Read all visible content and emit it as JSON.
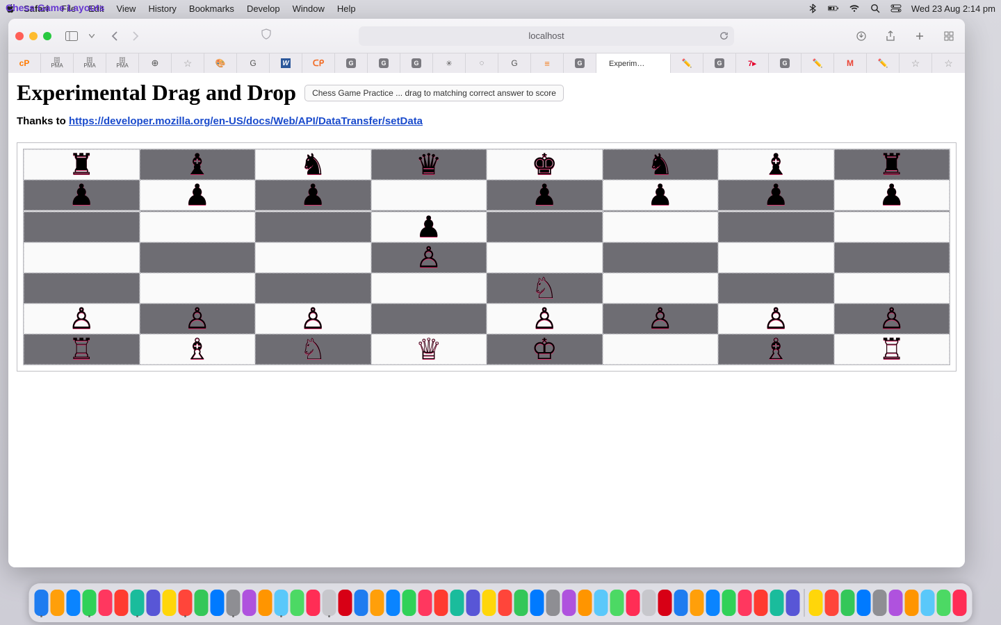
{
  "menubar": {
    "app": "Safari",
    "items": [
      "File",
      "Edit",
      "View",
      "History",
      "Bookmarks",
      "Develop",
      "Window",
      "Help"
    ],
    "clock": "Wed 23 Aug  2:14 pm"
  },
  "bg_window_title": "Chess Game Layouts",
  "safari": {
    "address": "localhost",
    "active_tab": "Experim…"
  },
  "page": {
    "heading": "Experimental Drag and Drop",
    "pill": "Chess Game Practice ... drag to matching correct answer to score",
    "thanks_prefix": "Thanks to ",
    "thanks_link": "https://developer.mozilla.org/en-US/docs/Web/API/DataTransfer/setData"
  },
  "board": {
    "rows": [
      [
        "♜",
        "♝",
        "♞",
        "♛",
        "♚",
        "♞",
        "♝",
        "♜"
      ],
      [
        "♟",
        "♟",
        "♟",
        "",
        "♟",
        "♟",
        "♟",
        "♟"
      ],
      [
        "",
        "",
        "",
        "",
        "",
        "",
        "",
        ""
      ],
      [
        "",
        "",
        "",
        "♟",
        "",
        "",
        "",
        ""
      ],
      [
        "",
        "",
        "",
        "♙",
        "",
        "",
        "",
        ""
      ],
      [
        "",
        "",
        "",
        "",
        "♘",
        "",
        "",
        ""
      ],
      [
        "♙",
        "♙",
        "♙",
        "",
        "♙",
        "♙",
        "♙",
        "♙"
      ],
      [
        "♖",
        "♗",
        "♘",
        "♕",
        "♔",
        "",
        "♗",
        "♖"
      ]
    ],
    "dark_first_row_odd": true
  },
  "dock_count": 58
}
